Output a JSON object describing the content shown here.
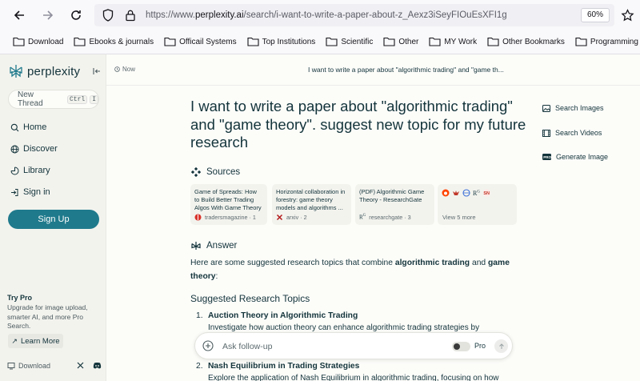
{
  "browser": {
    "url_prefix": "https://www.",
    "url_domain": "perplexity.ai",
    "url_path": "/search/i-want-to-write-a-paper-about-z_Aexz3iSeyFIOuEsXFI1g",
    "zoom": "60%"
  },
  "bookmarks": [
    {
      "label": "Download"
    },
    {
      "label": "Ebooks & journals"
    },
    {
      "label": "Officail Systems"
    },
    {
      "label": "Top Institutions"
    },
    {
      "label": "Scientific"
    },
    {
      "label": "Other"
    },
    {
      "label": "MY Work"
    },
    {
      "label": "Other Bookmarks"
    },
    {
      "label": "Programming"
    }
  ],
  "sidebar": {
    "logo": "perplexity",
    "new_thread": "New Thread",
    "shortcut_1": "Ctrl",
    "shortcut_2": "I",
    "nav": [
      {
        "label": "Home",
        "icon": "search-icon"
      },
      {
        "label": "Discover",
        "icon": "globe-icon"
      },
      {
        "label": "Library",
        "icon": "library-icon"
      },
      {
        "label": "Sign in",
        "icon": "sign-in-icon"
      }
    ],
    "signup": "Sign Up",
    "try_pro_title": "Try Pro",
    "try_pro_desc": "Upgrade for image upload, smarter AI, and more Pro Search.",
    "learn_more": "Learn More",
    "download": "Download"
  },
  "topbar": {
    "time": "Now",
    "title": "I want to write a paper about \"algorithmic trading\" and \"game th..."
  },
  "question": "I want to write a paper about \"algorithmic trading\" and \"game theory\". suggest new topic for my future research",
  "sources": {
    "heading": "Sources",
    "items": [
      {
        "title": "Game of Spreads: How to Build Better Trading Algos With Game Theory",
        "site": "tradersmagazine · 1"
      },
      {
        "title": "Horizontal collaboration in forestry: game theory models and algorithms ...",
        "site": "arxiv · 2"
      },
      {
        "title": "(PDF) Algorithmic Game Theory - ResearchGate",
        "site": "researchgate · 3"
      }
    ],
    "view_more": "View 5 more"
  },
  "answer": {
    "heading": "Answer",
    "intro_1": "Here are some suggested research topics that combine ",
    "intro_b1": "algorithmic trading",
    "intro_2": " and ",
    "intro_b2": "game theory",
    "intro_3": ":",
    "subheading": "Suggested Research Topics",
    "topics": [
      {
        "num": "1.",
        "title": "Auction Theory in Algorithmic Trading",
        "desc": "Investigate how auction theory can enhance algorithmic trading strategies by"
      },
      {
        "num": "2.",
        "title": "Nash Equilibrium in Trading Strategies",
        "desc": "Explore the application of Nash Equilibrium in algorithmic trading, focusing on how"
      }
    ]
  },
  "right_panel": {
    "search_images": "Search Images",
    "search_videos": "Search Videos",
    "generate_image": "Generate Image"
  },
  "followup": {
    "placeholder": "Ask follow-up",
    "pro": "Pro"
  },
  "colors": {
    "accent": "#1f7a8c",
    "sidebar_bg": "#f3f3ee",
    "page_bg": "#fcfcf9",
    "text": "#13343b"
  }
}
